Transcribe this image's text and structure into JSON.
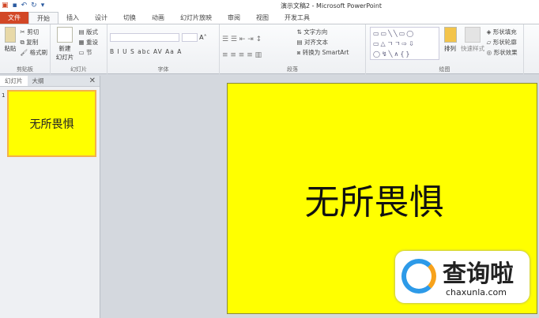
{
  "window": {
    "title": "演示文稿2 - Microsoft PowerPoint"
  },
  "qat": [
    "save-icon",
    "undo-icon",
    "redo-icon",
    "customize-icon"
  ],
  "tabs": [
    "文件",
    "开始",
    "插入",
    "设计",
    "切换",
    "动画",
    "幻灯片放映",
    "审阅",
    "视图",
    "开发工具"
  ],
  "ribbon": {
    "clipboard": {
      "paste": "粘贴",
      "cut": "剪切",
      "copy": "复制",
      "format_painter": "格式刷",
      "label": "剪贴板"
    },
    "slides": {
      "new": "新建",
      "new2": "幻灯片",
      "layout": "版式",
      "reset": "重设",
      "section": "节",
      "label": "幻灯片"
    },
    "font": {
      "label": "字体",
      "buttons": "B I U S abc AV Aa A"
    },
    "paragraph": {
      "text_direction": "文字方向",
      "align_text": "对齐文本",
      "smartart": "转换为 SmartArt",
      "label": "段落"
    },
    "drawing": {
      "arrange": "排列",
      "quick_styles": "快速样式",
      "fill": "形状填充",
      "outline": "形状轮廓",
      "effects": "形状效果",
      "label": "绘图"
    }
  },
  "panel": {
    "tabs": [
      "幻灯片",
      "大纲"
    ],
    "slide_number": "1",
    "thumb_text": "无所畏惧"
  },
  "slide": {
    "text": "无所畏惧"
  },
  "watermark": {
    "text": "查询啦",
    "url": "chaxunla.com"
  }
}
